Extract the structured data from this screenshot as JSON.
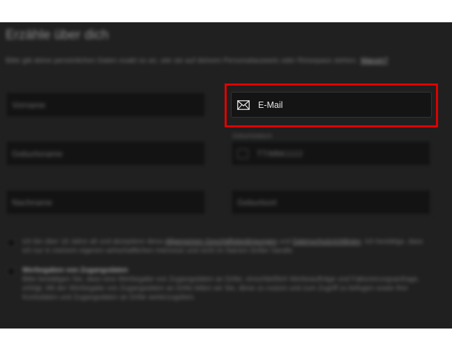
{
  "form": {
    "title": "Erzähle über dich",
    "intro_text": "Bitte gib deine persönlichen Daten exakt so an, wie sie auf deinem Personalausweis oder Reisepass stehen.",
    "intro_link": "Warum?",
    "fields": {
      "vorname_placeholder": "Vorname",
      "email_label": "E-Mail",
      "geburtsname_placeholder": "Geburtsname",
      "geburtsdatum_label": "Geburtsdatum",
      "geburtsdatum_placeholder": "TT/MM/JJJJ",
      "nachname_placeholder": "Nachname",
      "geburtsort_placeholder": "Geburtsort"
    },
    "consent": {
      "age_text_a": "Ich bin über 18 Jahre alt und akzeptiere diese",
      "age_link_1": "Allgemeinen Geschäftsbedingungen",
      "age_text_b": "und",
      "age_link_2": "Datenschutzrichtlinien",
      "age_text_c": ". Ich bestätige, dass ich nur in meinem eigenen wirtschaftlichen Interesse und nicht im Namen Dritter handle.",
      "bonus_title": "Werbegaben von Zugangsdaten",
      "bonus_text": "Bitte bestätigen Sie, dass eine Werbegabe von Zugangsdaten an Dritte, einschließlich Werbeaufträge und Fakturierungsanfrage, erfolgt. Mit der Werbegabe von Zugangsdaten an Dritte bitten wir Sie, diese zu nutzen und zum Zugriff zu befugen sowie Ihre Kontodaten und Zugangsdaten an Dritte weiterzugeben."
    }
  },
  "colors": {
    "page_background": "#202020",
    "field_background": "#131313",
    "highlight": "#e00000"
  },
  "icons": {
    "email": "envelope-icon",
    "date": "calendar-icon"
  }
}
